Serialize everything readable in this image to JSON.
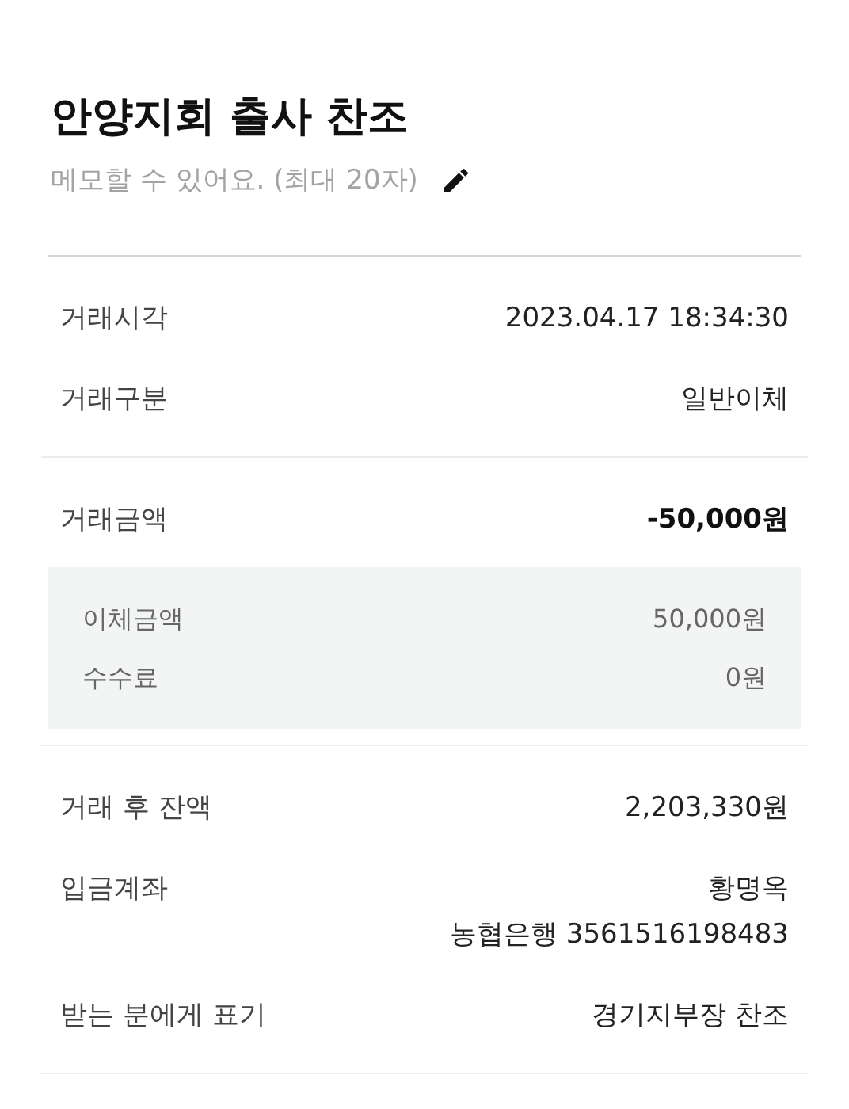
{
  "title": "안양지회 출사 찬조",
  "memo": {
    "placeholder": "메모할 수 있어요. (최대 20자)"
  },
  "sections": [
    {
      "items": [
        {
          "kind": "row",
          "label": "거래시각",
          "values": [
            "2023.04.17 18:34:30"
          ]
        },
        {
          "kind": "row",
          "label": "거래구분",
          "values": [
            "일반이체"
          ]
        }
      ]
    },
    {
      "items": [
        {
          "kind": "amount",
          "label": "거래금액",
          "values": [
            "-50,000원"
          ]
        },
        {
          "kind": "breakdown",
          "rows": [
            {
              "label": "이체금액",
              "value": "50,000원"
            },
            {
              "label": "수수료",
              "value": "0원"
            }
          ]
        }
      ]
    },
    {
      "items": [
        {
          "kind": "row",
          "label": "거래 후 잔액",
          "values": [
            "2,203,330원"
          ]
        },
        {
          "kind": "row",
          "label": "입금계좌",
          "values": [
            "황명옥",
            "농협은행 3561516198483"
          ]
        },
        {
          "kind": "row",
          "label": "받는 분에게 표기",
          "values": [
            "경기지부장 찬조"
          ]
        }
      ]
    }
  ]
}
